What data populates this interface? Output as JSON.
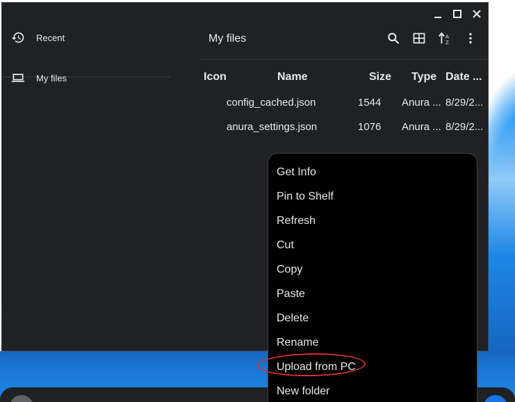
{
  "window": {
    "controls": {
      "minimize_icon": "minimize-icon",
      "maximize_icon": "maximize-icon",
      "close_icon": "close-icon"
    }
  },
  "sidebar": {
    "items": [
      {
        "label": "Recent",
        "icon": "history-icon"
      },
      {
        "label": "My files",
        "icon": "laptop-icon"
      }
    ]
  },
  "main": {
    "title": "My files",
    "toolbar": {
      "search_icon": "search-icon",
      "grid_icon": "grid-view-icon",
      "sort_icon": "sort-icon",
      "more_icon": "more-vert-icon"
    },
    "columns": [
      "Icon",
      "Name",
      "Size",
      "Type",
      "Date ..."
    ],
    "rows": [
      {
        "name": "config_cached.json",
        "size": "1544",
        "type": "Anura ...",
        "date": "8/29/2..."
      },
      {
        "name": "anura_settings.json",
        "size": "1076",
        "type": "Anura ...",
        "date": "8/29/2..."
      }
    ]
  },
  "context_menu": {
    "items": [
      "Get Info",
      "Pin to Shelf",
      "Refresh",
      "Cut",
      "Copy",
      "Paste",
      "Delete",
      "Rename",
      "Upload from PC",
      "New folder"
    ],
    "highlighted_item": "Upload from PC",
    "highlight_color": "#d32f2f"
  },
  "colors": {
    "window_bg": "#202124",
    "text": "#e8eaed",
    "menu_bg": "#000000",
    "wallpaper_blue": "#1e88e5"
  }
}
